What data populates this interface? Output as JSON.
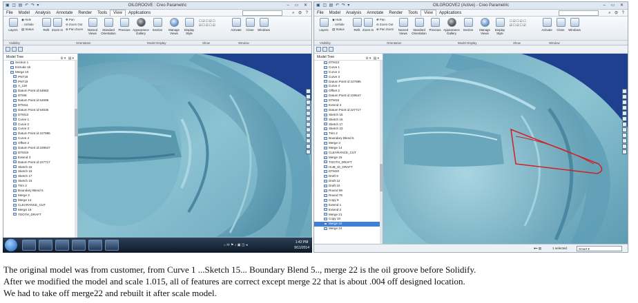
{
  "left_window": {
    "title": "OILGROOVE : Creo Parametric",
    "menu": [
      "File",
      "Model",
      "Analysis",
      "Annotate",
      "Render",
      "Tools",
      "View",
      "Applications"
    ],
    "active_menu": "View",
    "ribbon": {
      "layers": "Layers",
      "hide": "Hide",
      "unhide": "Unhide",
      "status": "Status",
      "refit": "Refit",
      "zoom_in": "Zoom In",
      "pan": "Pan",
      "zoom_out": "Zoom Out",
      "pan_zoom": "Pan Zoom",
      "named_views": "Named Views",
      "standard_orientation": "Standard Orientation",
      "previous": "Previous",
      "appearance_gallery": "Appearance Gallery",
      "section": "Section",
      "manage_views": "Manage Views",
      "display_style": "Display Style",
      "activate": "Activate",
      "close": "Close",
      "windows": "Windows"
    },
    "groups": [
      "Visibility",
      "Orientation",
      "Model Display",
      "Show",
      "Window"
    ],
    "tree_header": "Model Tree",
    "tree_items": [
      "Section 1",
      "Extrude 1b",
      "Merge 10",
      "PNT18",
      "PNT19",
      "A_119",
      "Datum Point id 54583",
      "DTM8",
      "Datum Point id 54699",
      "DTM11",
      "Datum Point id 54635",
      "DTM13",
      "Curve 1",
      "Curve 2",
      "Curve 3",
      "Datum Point id 227895",
      "Curve 4",
      "Offset 2",
      "Datum Point id 229547",
      "DTM19",
      "Extend 3",
      "Datum Point id 227717",
      "Sketch 15",
      "Sketch 16",
      "Sketch 17",
      "Sketch 23",
      "Trim 2",
      "Boundary Blend 5",
      "Merge 3",
      "Merge 14",
      "CLEARANCE_CUT",
      "Merge 16",
      "TOOTH_DRAFT"
    ],
    "status": "• Showing feature 87 (BOUNDARY_1) in part OILGROOVE."
  },
  "right_window": {
    "title": "OILGROOVE2 (Active) - Creo Parametric",
    "menu": [
      "File",
      "Model",
      "Analysis",
      "Annotate",
      "Render",
      "Tools",
      "View",
      "Applications"
    ],
    "active_menu": "View",
    "tree_header": "Model Tree",
    "tree_items": [
      "DTM13",
      "Curve 1",
      "Curve 2",
      "Curve 3",
      "Datum Point id 227895",
      "Curve 4",
      "Offset 2",
      "Datum Point id 229547",
      "DTM19",
      "Extend 3",
      "Datum Point id 227717",
      "Sketch 15",
      "Sketch 16",
      "Sketch 17",
      "Sketch 23",
      "Trim 2",
      "Boundary Blend 5",
      "Merge 3",
      "Merge 14",
      "CLEARANCE_CUT",
      "Merge 15",
      "TOOTH_DRAFT",
      "HUB_ID_DRAFT",
      "DTM20",
      "Draft 9",
      "Draft 12",
      "Draft 10",
      "Round 59",
      "Round 76",
      "Copy 9",
      "Extend 1",
      "Extend 2",
      "Merge 21",
      "Copy 10",
      "Merge 22",
      "Merge 24"
    ],
    "selected_item": "Merge 22",
    "status_selected": "1 selected",
    "filter": "Smart"
  },
  "taskbar": {
    "time": "1:42 PM",
    "date": "9/11/2014"
  },
  "caption": [
    "The original model was from customer, from Curve 1 ...Sketch 15... Boundary Blend 5.., merge 22 is the oil groove before Solidify.",
    "After we modified the model and scale 1.015, all of features are correct except merge 22 that is about .004 off designed location.",
    "We had to take off merge22 and rebuilt it after scale model."
  ],
  "colors": {
    "model_surface": "#7fb5c7",
    "viewport_sky": "#1f3f8f",
    "groove_highlight": "#d02020",
    "selection": "#3d7fd6"
  }
}
